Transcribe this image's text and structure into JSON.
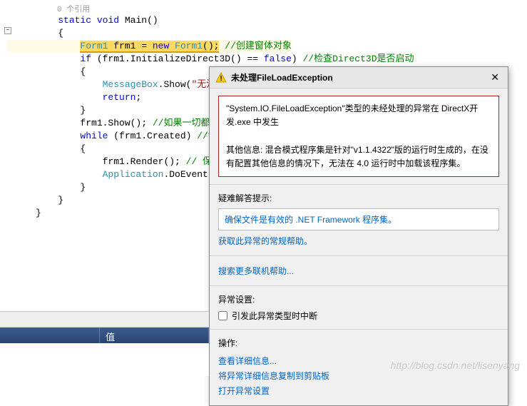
{
  "code": {
    "ref_count": "0 个引用",
    "line1_kw1": "static",
    "line1_kw2": "void",
    "line1_name": "Main()",
    "brace_open": "{",
    "brace_close": "}",
    "hl_type1": "Form1",
    "hl_var": " frm1 = ",
    "hl_kw": "new",
    "hl_type2": " Form1",
    "hl_call": "();",
    "hl_comment": " //创建窗体对象",
    "l4_kw": "if",
    "l4_expr": " (frm1.InitializeDirect3D() == ",
    "l4_false": "false",
    "l4_paren": ") ",
    "l4_comment": "//检查Direct3D是否启动",
    "l6_cls": "MessageBox",
    "l6_call": ".Show(",
    "l6_str": "\"无法启",
    "l7_kw": "return",
    "l7_semi": ";",
    "l9a": "frm1.Show(); ",
    "l9b": "//如果一切都初",
    "l10_kw": "while",
    "l10a": " (frm1.Created) ",
    "l10b": "//设置",
    "l12a": "frm1.Render(); ",
    "l12b": "// 保持de",
    "l13_cls": "Application",
    "l13_call": ".DoEvents()"
  },
  "dialog": {
    "title": "未处理FileLoadException",
    "error_msg": "\"System.IO.FileLoadException\"类型的未经处理的异常在 DirectX开发.exe 中发生\n\n其他信息: 混合模式程序集是针对\"v1.1.4322\"版的运行时生成的，在没有配置其他信息的情况下，无法在 4.0 运行时中加载该程序集。",
    "suggest_label": "疑难解答提示:",
    "suggest_text": "确保文件是有效的 .NET Framework 程序集。",
    "help_link": "获取此异常的常规帮助。",
    "search_link": "搜索更多联机帮助...",
    "exc_settings_label": "异常设置:",
    "exc_checkbox": "引发此异常类型时中断",
    "actions_label": "操作:",
    "action1": "查看详细信息...",
    "action2": "将异常详细信息复制到剪贴板",
    "action3": "打开异常设置"
  },
  "grid": {
    "col2": "值"
  },
  "watermark": "http://blog.csdn.net/lisenyang"
}
